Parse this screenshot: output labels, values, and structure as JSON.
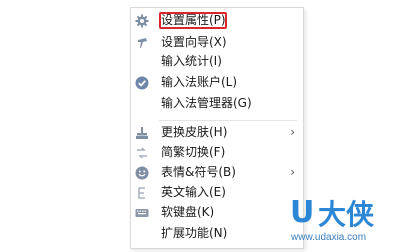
{
  "menu": {
    "items": [
      {
        "label": "设置属性(P)",
        "icon": "gear-icon",
        "highlighted": true
      },
      {
        "label": "设置向导(X)",
        "icon": "wand-icon"
      },
      {
        "label": "输入统计(I)",
        "icon": ""
      },
      {
        "label": "输入法账户(L)",
        "icon": "check-circle-icon"
      },
      {
        "label": "输入法管理器(G)",
        "icon": ""
      },
      {
        "label": "更换皮肤(H)",
        "icon": "skin-icon",
        "submenu": true
      },
      {
        "label": "简繁切换(F)",
        "icon": "convert-icon"
      },
      {
        "label": "表情&符号(B)",
        "icon": "smiley-icon",
        "submenu": true
      },
      {
        "label": "英文输入(E)",
        "icon": "english-icon"
      },
      {
        "label": "软键盘(K)",
        "icon": "keyboard-icon"
      },
      {
        "label": "扩展功能(N)",
        "icon": ""
      }
    ],
    "submenu_arrow": "›"
  },
  "watermark": {
    "logo_letter": "U",
    "logo_text": "大侠",
    "url": "www.udaxia.com"
  },
  "colors": {
    "highlight_border": "#d8262c",
    "watermark_blue": "#2b86d6",
    "icon_gray": "#8a97a8"
  }
}
